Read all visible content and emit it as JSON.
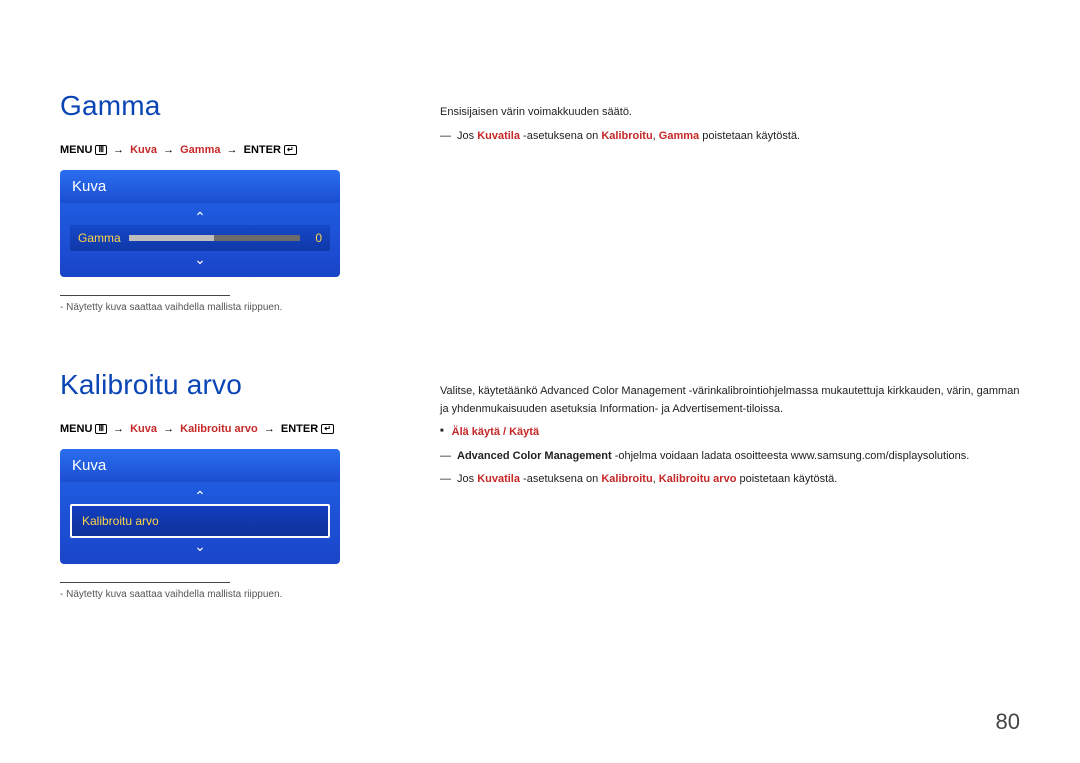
{
  "page_number": "80",
  "s1": {
    "title": "Gamma",
    "path": {
      "menu": "MENU",
      "arrow": "→",
      "seg1": "Kuva",
      "seg2": "Gamma",
      "enter": "ENTER"
    },
    "ui": {
      "header": "Kuva",
      "label": "Gamma",
      "value": "0"
    },
    "footnote": "Näytetty kuva saattaa vaihdella mallista riippuen.",
    "right": {
      "p1": "Ensisijaisen värin voimakkuuden säätö.",
      "note": {
        "pre": "Jos ",
        "kw1": "Kuvatila",
        "mid1": " -asetuksena on ",
        "kw2": "Kalibroitu",
        "mid2": ", ",
        "kw3": "Gamma",
        "post": " poistetaan käytöstä."
      }
    }
  },
  "s2": {
    "title": "Kalibroitu arvo",
    "path": {
      "menu": "MENU",
      "arrow": "→",
      "seg1": "Kuva",
      "seg2": "Kalibroitu arvo",
      "enter": "ENTER"
    },
    "ui": {
      "header": "Kuva",
      "label": "Kalibroitu arvo"
    },
    "footnote": "Näytetty kuva saattaa vaihdella mallista riippuen.",
    "right": {
      "p1a": "Valitse, käytetäänkö ",
      "p1b": "Advanced Color Management",
      "p1c": " -värinkalibrointiohjelmassa mukautettuja kirkkauden, värin, gamman ja yhdenmukaisuuden asetuksia Information- ja Advertisement-tiloissa.",
      "bullet": "Älä käytä / Käytä",
      "note1": {
        "kw1": "Advanced Color Management",
        "rest": " -ohjelma voidaan ladata osoitteesta www.samsung.com/displaysolutions."
      },
      "note2": {
        "pre": "Jos ",
        "kw1": "Kuvatila",
        "mid1": " -asetuksena on ",
        "kw2": "Kalibroitu",
        "mid2": ", ",
        "kw3": "Kalibroitu arvo",
        "post": " poistetaan käytöstä."
      }
    }
  }
}
